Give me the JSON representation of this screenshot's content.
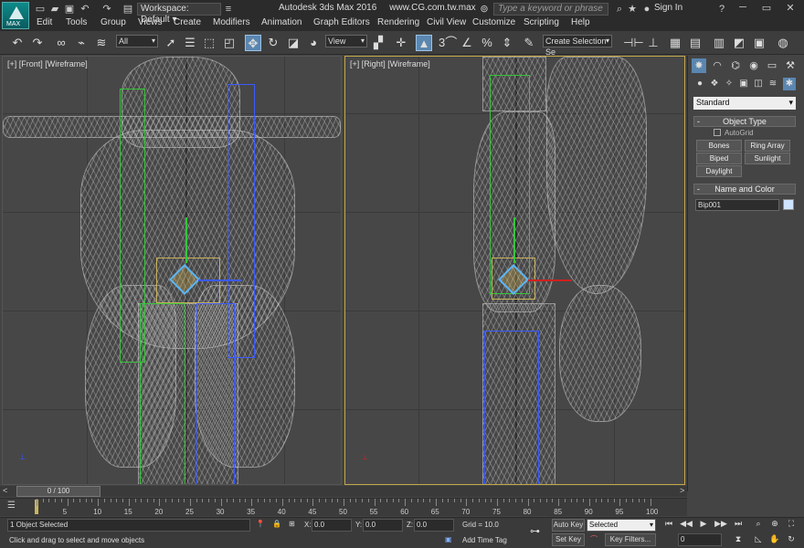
{
  "titlebar": {
    "logo_text": "MAX",
    "workspace": "Workspace: Default",
    "app_title": "Autodesk 3ds Max 2016",
    "file_title": "www.CG.com.tw.max",
    "search_placeholder": "Type a keyword or phrase",
    "sign_in": "Sign In"
  },
  "menu": [
    "Edit",
    "Tools",
    "Group",
    "Views",
    "Create",
    "Modifiers",
    "Animation",
    "Graph Editors",
    "Rendering",
    "Civil View",
    "Customize",
    "Scripting",
    "Help"
  ],
  "toolbar": {
    "filter_select": "All",
    "ref_coord_select": "View",
    "snap_value": "3",
    "selection_set": "Create Selection Se"
  },
  "viewports": {
    "front_label": "[+] [Front] [Wireframe]",
    "right_label": "[+] [Right] [Wireframe]"
  },
  "command_panel": {
    "category_select": "Standard",
    "object_type_title": "Object Type",
    "autogrid": "AutoGrid",
    "buttons": [
      "Bones",
      "Ring Array",
      "Biped",
      "Sunlight",
      "Daylight"
    ],
    "name_color_title": "Name and Color",
    "name_value": "Bip001",
    "swatch_color": "#cfe4ff"
  },
  "timeline": {
    "slider_label": "0 / 100",
    "current_frame": 0,
    "ticks": [
      0,
      5,
      10,
      15,
      20,
      25,
      30,
      35,
      40,
      45,
      50,
      55,
      60,
      65,
      70,
      75,
      80,
      85,
      90,
      95,
      100
    ]
  },
  "status": {
    "selection_text": "1 Object Selected",
    "prompt_text": "Click and drag to select and move objects",
    "x_label": "X:",
    "x_value": "0.0",
    "y_label": "Y:",
    "y_value": "0.0",
    "z_label": "Z:",
    "z_value": "0.0",
    "grid_text": "Grid = 10.0",
    "auto_key": "Auto Key",
    "key_mode_select": "Selected",
    "set_key": "Set Key",
    "key_filters": "Key Filters...",
    "add_time_tag": "Add Time Tag",
    "frame_field": "0"
  },
  "colors": {
    "accent": "#5a86b0",
    "active_viewport_border": "#c5a84a",
    "bone_green": "#36c53a",
    "bone_blue": "#3a5aff"
  }
}
